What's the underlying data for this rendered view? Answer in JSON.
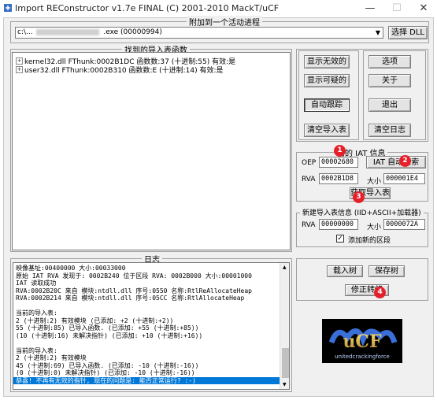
{
  "window": {
    "title": "Import REConstructor v1.7e FINAL (C) 2001-2010 MackT/uCF",
    "minimize_glyph": "—",
    "maximize_glyph": "☐",
    "close_glyph": "✕"
  },
  "attach": {
    "label": "附加到一个活动进程",
    "process_value": "c:\\...",
    "process_tail": ".exe (00000994)",
    "select_dll_label": "选择 DLL"
  },
  "imports": {
    "label": "找到的导入表函数",
    "rows": [
      "kernel32.dll FThunk:0002B1DC 函数数:37 (十进制:55) 有效:是",
      "user32.dll FThunk:0002B310 函数数:E (十进制:14) 有效:是"
    ]
  },
  "buttons": {
    "show_invalid": "显示无效的",
    "options": "选项",
    "show_suspect": "显示可疑的",
    "about": "关于",
    "auto_trace": "自动跟踪",
    "exit": "退出",
    "clear_imports": "清空导入表",
    "clear_log": "清空日志"
  },
  "iat": {
    "label": "需的 IAT 信息",
    "oep_label": "OEP",
    "oep_value": "00002680",
    "autosearch_label": "IAT 自动搜索",
    "rva_label": "RVA",
    "rva_value": "0002B1D8",
    "size_label": "大小",
    "size_value": "000001E4",
    "get_imports_label": "获取导入表"
  },
  "newiat": {
    "label": "新建导入表信息 (IID+ASCII+加载器)",
    "rva_label": "RVA",
    "rva_value": "00000000",
    "size_label": "大小",
    "size_value": "0000072A",
    "add_section_label": "添加新的区段",
    "add_section_checked": true
  },
  "log": {
    "label": "日志",
    "lines": [
      "映像基址:00400000 大小:00033000",
      "原始 IAT RVA 发现于: 0002B240 位于区段 RVA: 0002B000 大小:00001000",
      "IAT 读取成功",
      "RVA:0002B20C 来自 模块:ntdll.dll 序号:0550 名称:RtlReAllocateHeap",
      "RVA:0002B214 来自 模块:ntdll.dll 序号:05CC 名称:RtlAllocateHeap",
      "",
      "当前的导入表:",
      "2 (十进制:2) 有效模块 (已添加: +2 (十进制:+2))",
      "55 (十进制:85) 已导入函数. (已添加: +55 (十进制:+85))",
      "(10 (十进制:16) 未解决指针) (已添加: +10 (十进制:+16))",
      "",
      "当前的导入表:",
      "2 (十进制:2) 有效模块",
      "45 (十进制:69) 已导入函数. (已添加: -10 (十进制:-16))",
      "(0 (十进制:0) 未解决指针) (已添加: -10 (十进制:-16))",
      "恭喜! 不再有无效的指针, 现在的问题是: 能否正常运行? :-)"
    ]
  },
  "tree_buttons": {
    "load_tree": "载入树",
    "save_tree": "保存树",
    "fix_dump": "修正转储"
  },
  "badges": [
    "1",
    "2",
    "3",
    "4"
  ],
  "logo": {
    "text": "uCF",
    "subtext": "unitedcrackingforce"
  },
  "colors": {
    "selection": "#0078d7",
    "badge": "#e6202a"
  }
}
